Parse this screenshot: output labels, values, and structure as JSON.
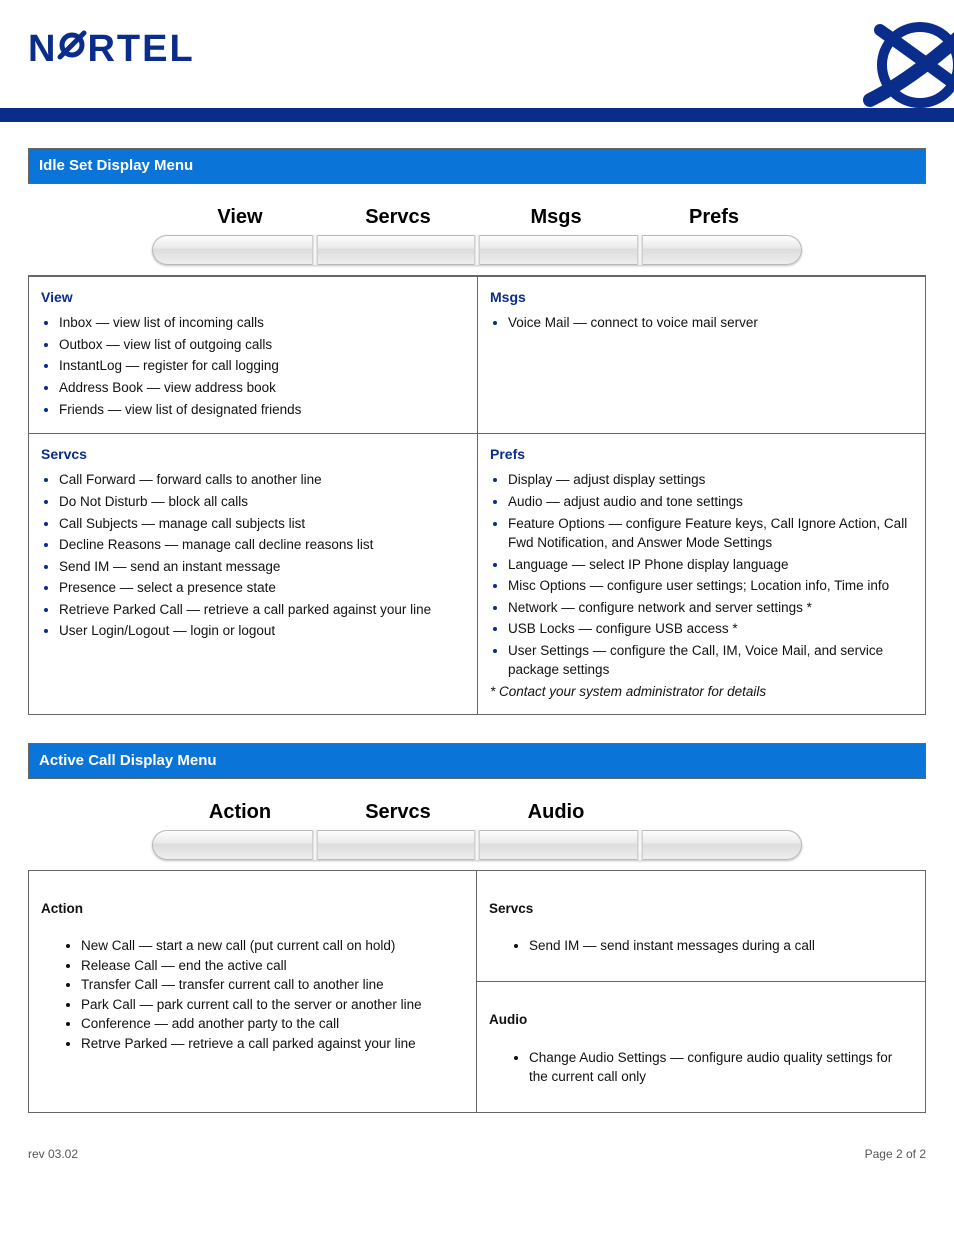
{
  "brand": {
    "name_left": "N",
    "name_right": "RTEL",
    "full": "NORTEL"
  },
  "footer": {
    "revision": "rev 03.02",
    "page": "Page 2 of 2"
  },
  "section1": {
    "title": "Idle Set Display Menu",
    "softkeys": [
      "View",
      "Servcs",
      "Msgs",
      "Prefs"
    ],
    "cells": {
      "view": {
        "heading": "View",
        "items": [
          "Inbox — view list of incoming calls",
          "Outbox — view list of outgoing calls",
          "InstantLog — register for call logging",
          "Address Book — view address book",
          "Friends — view list of designated friends"
        ]
      },
      "msgs": {
        "heading": "Msgs",
        "items": [
          "Voice Mail — connect to voice mail server"
        ]
      },
      "servcs": {
        "heading": "Servcs",
        "items": [
          "Call Forward — forward calls to another line",
          "Do Not Disturb — block all calls",
          "Call Subjects — manage call subjects list",
          "Decline Reasons — manage call decline reasons list",
          "Send IM — send an instant message",
          "Presence — select a presence state",
          "Retrieve Parked Call — retrieve a call parked against your line",
          "User Login/Logout — login or logout"
        ]
      },
      "prefs": {
        "heading": "Prefs",
        "items": [
          "Display — adjust display settings",
          "Audio — adjust audio and tone settings",
          "Feature Options — configure Feature keys, Call Ignore Action, Call Fwd Notification, and Answer Mode Settings",
          "Language — select IP Phone display language",
          "Misc Options — configure user settings; Location info, Time info",
          "Network — configure network and server settings *",
          "USB Locks — configure USB access *",
          "User Settings — configure the Call, IM, Voice Mail, and service package settings"
        ],
        "note": "* Contact your system administrator for details"
      }
    }
  },
  "section2": {
    "title": "Active Call Display Menu",
    "softkeys": [
      "Action",
      "Servcs",
      "Audio",
      ""
    ],
    "left": {
      "heading": "Action",
      "items": [
        "New Call — start a new call (put current call on hold)",
        "Release Call — end the active call",
        "Transfer Call — transfer current call to another line",
        "Park Call — park current call to the server or another line",
        "Conference — add another party to the call",
        "Retrve Parked — retrieve a call parked against your line"
      ]
    },
    "right_top": {
      "heading": "Servcs",
      "items": [
        "Send IM — send instant messages during a call"
      ]
    },
    "right_bottom": {
      "heading": "Audio",
      "items": [
        "Change Audio Settings — configure audio quality settings for the current call only"
      ]
    }
  }
}
